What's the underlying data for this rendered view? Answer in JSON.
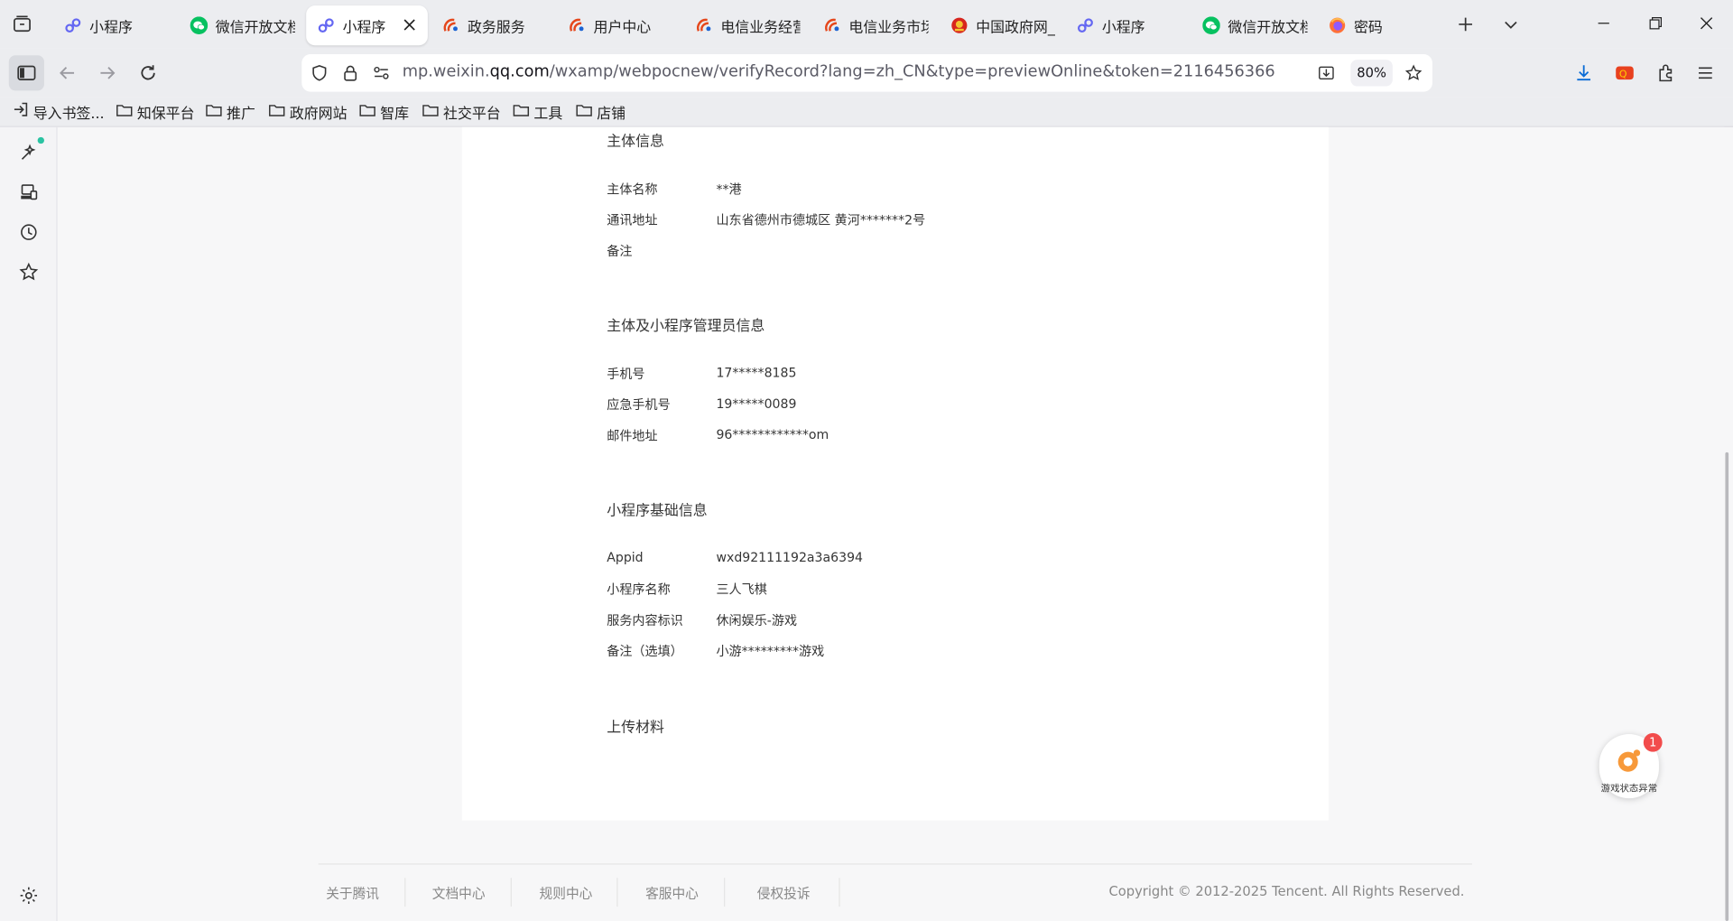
{
  "browser": {
    "tabs": [
      {
        "label": "小程序",
        "icon": "miniprogram-icon",
        "active": false
      },
      {
        "label": "微信开放文档",
        "icon": "wechat-icon",
        "active": false
      },
      {
        "label": "小程序",
        "icon": "miniprogram-icon",
        "active": true
      },
      {
        "label": "政务服务",
        "icon": "telecom-icon",
        "active": false
      },
      {
        "label": "用户中心",
        "icon": "telecom-icon",
        "active": false
      },
      {
        "label": "电信业务经营",
        "icon": "telecom-icon",
        "active": false
      },
      {
        "label": "电信业务市场",
        "icon": "telecom-icon",
        "active": false
      },
      {
        "label": "中国政府网_",
        "icon": "gov-emblem-icon",
        "active": false
      },
      {
        "label": "小程序",
        "icon": "miniprogram-icon",
        "active": false
      },
      {
        "label": "微信开放文档",
        "icon": "wechat-icon",
        "active": false
      },
      {
        "label": "密码",
        "icon": "firefox-icon",
        "active": false
      }
    ],
    "url": {
      "prefix": "mp.weixin.",
      "host": "qq.com",
      "path": "/wxamp/webpocnew/verifyRecord?lang=zh_CN&type=previewOnline&token=2116456366"
    },
    "zoom": "80%",
    "bookmarks": [
      {
        "label": "导入书签...",
        "icon": "import-icon"
      },
      {
        "label": "知保平台",
        "icon": "folder-icon"
      },
      {
        "label": "推广",
        "icon": "folder-icon"
      },
      {
        "label": "政府网站",
        "icon": "folder-icon"
      },
      {
        "label": "智库",
        "icon": "folder-icon"
      },
      {
        "label": "社交平台",
        "icon": "folder-icon"
      },
      {
        "label": "工具",
        "icon": "folder-icon"
      },
      {
        "label": "店铺",
        "icon": "folder-icon"
      }
    ]
  },
  "page": {
    "sections": [
      {
        "title": "主体信息",
        "rows": [
          {
            "label": "主体名称",
            "value": "**港"
          },
          {
            "label": "通讯地址",
            "value": "山东省德州市德城区 黄河*******2号"
          },
          {
            "label": "备注",
            "value": ""
          }
        ]
      },
      {
        "title": "主体及小程序管理员信息",
        "rows": [
          {
            "label": "手机号",
            "value": "17*****8185"
          },
          {
            "label": "应急手机号",
            "value": "19*****0089"
          },
          {
            "label": "邮件地址",
            "value": "96************om"
          }
        ]
      },
      {
        "title": "小程序基础信息",
        "rows": [
          {
            "label": "Appid",
            "value": "wxd92111192a3a6394"
          },
          {
            "label": "小程序名称",
            "value": "三人飞棋"
          },
          {
            "label": "服务内容标识",
            "value": "休闲娱乐-游戏"
          },
          {
            "label": "备注（选填）",
            "value": "小游*********游戏"
          }
        ]
      },
      {
        "title": "上传材料",
        "rows": []
      }
    ],
    "footer": {
      "links": [
        "关于腾讯",
        "文档中心",
        "规则中心",
        "客服中心",
        "侵权投诉"
      ],
      "copyright": "Copyright © 2012-2025 Tencent. All Rights Reserved."
    },
    "float_widget": {
      "label": "游戏状态异常",
      "badge": "1"
    }
  }
}
